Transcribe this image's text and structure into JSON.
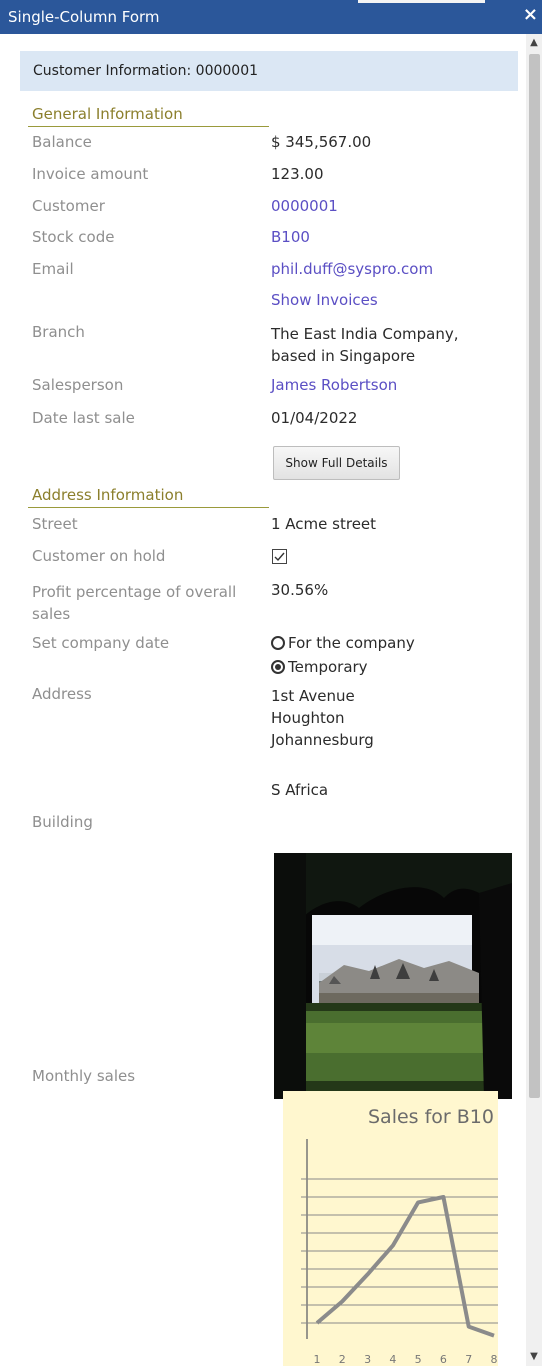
{
  "window": {
    "title": "Single-Column Form",
    "close_label": "×"
  },
  "header": {
    "text": "Customer Information: 0000001"
  },
  "sections": {
    "general": "General Information",
    "address": "Address Information"
  },
  "general_fields": [
    {
      "label": "Balance",
      "value": "$ 345,567.00"
    },
    {
      "label": "Invoice amount",
      "value": "123.00"
    },
    {
      "label": "Customer",
      "value": "0000001"
    },
    {
      "label": "Stock code",
      "value": "B100"
    },
    {
      "label": "Email",
      "value": "phil.duff@syspro.com"
    },
    {
      "label": "",
      "value": "Show Invoices"
    },
    {
      "label": "Branch",
      "value": "The East India Company,\nbased in Singapore"
    },
    {
      "label": "Salesperson",
      "value": "James Robertson"
    },
    {
      "label": "Date last sale",
      "value": "01/04/2022"
    }
  ],
  "buttons": {
    "show_full_details": "Show Full Details"
  },
  "address_fields": {
    "street_label": "Street",
    "street_value": "1 Acme street",
    "hold_label": "Customer on hold",
    "profit_label": "Profit percentage of overall\nsales",
    "profit_value": "30.56%",
    "date_label": "Set company date",
    "radio_1": "For the company",
    "radio_2": "Temporary",
    "address_label": "Address",
    "address_value": "1st Avenue\nHoughton\nJohannesburg",
    "country": "S Africa",
    "building_label": "Building",
    "monthly_label": "Monthly sales"
  },
  "chart_data": {
    "type": "line",
    "title": "Sales for B10",
    "categories": [
      "1",
      "2",
      "3",
      "4",
      "5",
      "6",
      "7",
      "8"
    ],
    "values": [
      1.0,
      2.2,
      3.7,
      5.3,
      7.7,
      8.0,
      0.8,
      0.3
    ],
    "ylim": [
      0,
      10
    ],
    "grid": true
  },
  "colors": {
    "titlebar": "#2b579a",
    "header_band": "#dbe7f4",
    "section": "#8b7f2c",
    "link": "#5b4fc4"
  }
}
